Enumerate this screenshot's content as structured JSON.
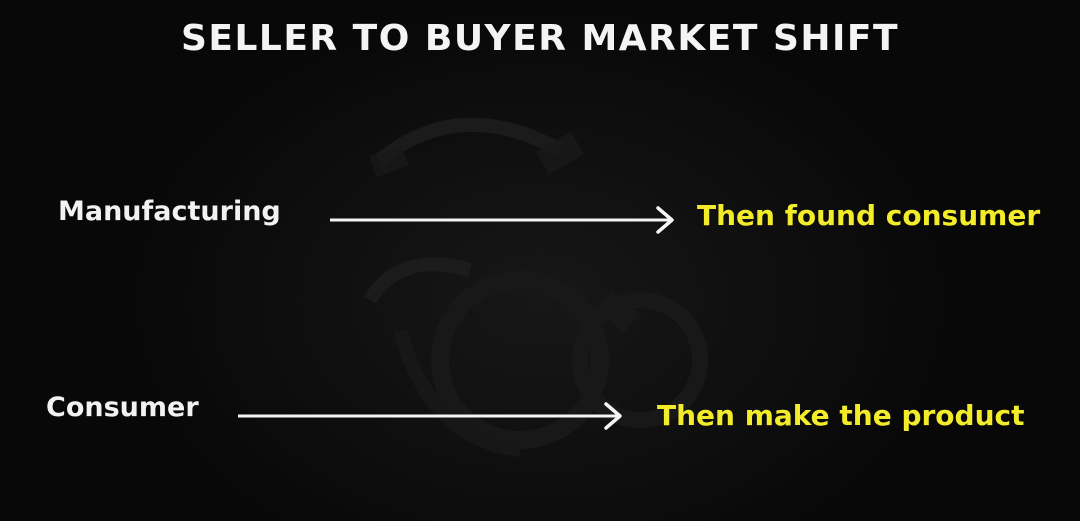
{
  "slide": {
    "title": "SELLER TO BUYER MARKET SHIFT",
    "rows": [
      {
        "left_text": "Manufacturing",
        "right_text": "Then found consumer"
      },
      {
        "left_text": "Consumer",
        "right_text": "Then make the product"
      }
    ]
  },
  "colors": {
    "background": "#0b0b0b",
    "title": "#f4f4f4",
    "left_text": "#f2f2f2",
    "right_text": "#f3ec2a",
    "arrow": "#f5f5f5"
  },
  "icons": [
    "right-arrow-icon",
    "gear-watermark"
  ]
}
